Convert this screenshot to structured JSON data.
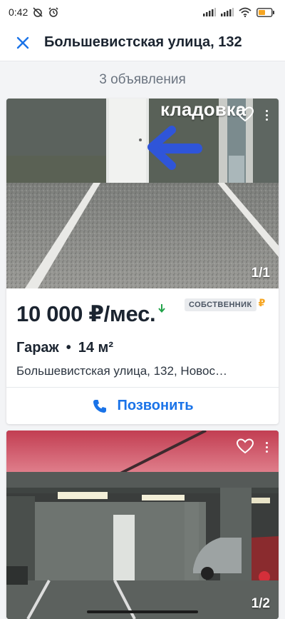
{
  "status_bar": {
    "time": "0:42",
    "icons": [
      "alarm-off-icon",
      "alarm-icon",
      "signal-icon",
      "signal-icon",
      "wifi-icon",
      "battery-icon"
    ]
  },
  "header": {
    "title": "Большевистская улица, 132",
    "close_icon": "close-icon"
  },
  "listing_count": "3 объявления",
  "colors": {
    "accent": "#1a73e8",
    "price_drop": "#22a34a",
    "ruble_badge": "#f6a623",
    "text_primary": "#1b2430",
    "text_secondary": "#6b7480",
    "background": "#f3f4f6"
  },
  "listings": [
    {
      "photo_caption": "кладовка",
      "photo_counter": "1/1",
      "price": "10 000 ₽/мес.",
      "price_indicator": "price-down-arrow-icon",
      "owner_badge": "СОБСТВЕННИК",
      "ruble_badge": "₽",
      "type": "Гараж",
      "area": "14 м²",
      "address": "Большевистская улица, 132, Новос…",
      "call_label": "Позвонить"
    },
    {
      "photo_counter": "1/2"
    }
  ]
}
